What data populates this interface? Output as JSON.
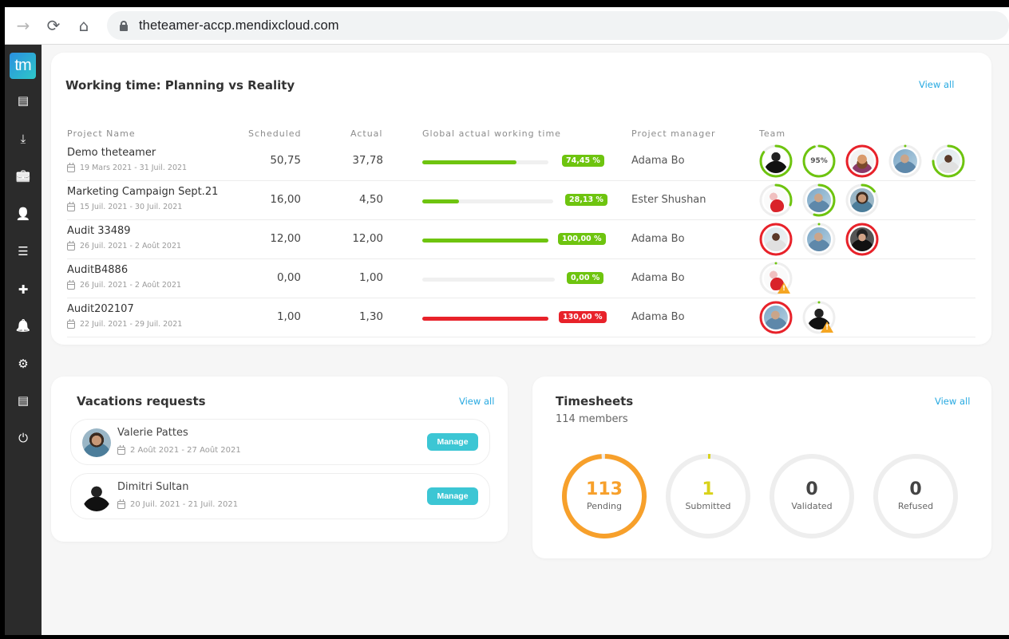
{
  "browser": {
    "url": "theteamer-accp.mendixcloud.com",
    "icons": [
      "forward-arrow-icon",
      "reload-icon",
      "home-icon",
      "lock-icon"
    ]
  },
  "sidebar": {
    "logo_text": "tm",
    "items": [
      {
        "name": "list-icon",
        "glyph": "▤"
      },
      {
        "name": "download-icon",
        "glyph": "⤓"
      },
      {
        "name": "briefcase-icon",
        "glyph": "💼"
      },
      {
        "name": "user-icon",
        "glyph": "👤"
      },
      {
        "name": "bullet-list-icon",
        "glyph": "☰"
      },
      {
        "name": "plus-icon",
        "glyph": "✚"
      },
      {
        "name": "bell-icon",
        "glyph": "🔔"
      },
      {
        "name": "gear-icon",
        "glyph": "⚙"
      },
      {
        "name": "report-icon",
        "glyph": "▤"
      },
      {
        "name": "power-icon",
        "glyph": "⏻"
      }
    ]
  },
  "working_time": {
    "title": "Working time: Planning vs Reality",
    "view_all": "View all",
    "headers": {
      "project": "Project Name",
      "scheduled": "Scheduled",
      "actual": "Actual",
      "global": "Global actual working time",
      "manager": "Project manager",
      "team": "Team"
    },
    "rows": [
      {
        "name": "Demo theteamer",
        "dates": "19 Mars 2021 - 31 Juil. 2021",
        "scheduled": "50,75",
        "actual": "37,78",
        "progress": 74.45,
        "percent_label": "74,45 %",
        "status": "ok",
        "manager": "Adama Bo",
        "team": [
          {
            "ring": 0.85,
            "status": "ok",
            "avatar": "dark"
          },
          {
            "ring": 0.95,
            "status": "ok",
            "label": "95%"
          },
          {
            "ring": 1.0,
            "status": "over",
            "avatar": "beard"
          },
          {
            "ring": 0.0,
            "status": "none",
            "avatar": "blue"
          },
          {
            "ring": 0.75,
            "status": "ok",
            "avatar": "smile"
          }
        ]
      },
      {
        "name": "Marketing Campaign Sept.21",
        "dates": "15 Juil. 2021 - 30 Juil. 2021",
        "scheduled": "16,00",
        "actual": "4,50",
        "progress": 28.13,
        "percent_label": "28,13 %",
        "status": "ok",
        "manager": "Ester Shushan",
        "team": [
          {
            "ring": 0.3,
            "status": "ok",
            "avatar": "red"
          },
          {
            "ring": 0.55,
            "status": "ok",
            "avatar": "blue"
          },
          {
            "ring": 0.15,
            "status": "ok",
            "avatar": "woman"
          }
        ]
      },
      {
        "name": "Audit 33489",
        "dates": "26 Juil. 2021 - 2 Août 2021",
        "scheduled": "12,00",
        "actual": "12,00",
        "progress": 100.0,
        "percent_label": "100,00 %",
        "status": "ok",
        "manager": "Adama Bo",
        "team": [
          {
            "ring": 1.0,
            "status": "over",
            "avatar": "smile"
          },
          {
            "ring": 0.0,
            "status": "none",
            "avatar": "blue"
          },
          {
            "ring": 1.0,
            "status": "over",
            "avatar": "darkhair"
          }
        ]
      },
      {
        "name": "AuditB4886",
        "dates": "26 Juil. 2021 - 2 Août 2021",
        "scheduled": "0,00",
        "actual": "1,00",
        "progress": 0.0,
        "percent_label": "0,00 %",
        "status": "ok",
        "manager": "Adama Bo",
        "team": [
          {
            "ring": 0.0,
            "status": "none",
            "avatar": "red",
            "warning": true
          }
        ]
      },
      {
        "name": "Audit202107",
        "dates": "22 Juil. 2021 - 29 Juil. 2021",
        "scheduled": "1,00",
        "actual": "1,30",
        "progress": 130.0,
        "percent_label": "130,00 %",
        "status": "over",
        "manager": "Adama Bo",
        "team": [
          {
            "ring": 1.0,
            "status": "over",
            "avatar": "blue"
          },
          {
            "ring": 0.0,
            "status": "none",
            "avatar": "dark",
            "warning": true
          }
        ]
      }
    ]
  },
  "vacations": {
    "title": "Vacations requests",
    "view_all": "View all",
    "items": [
      {
        "name": "Valerie Pattes",
        "dates": "2 Août 2021 - 27 Août 2021",
        "button": "Manage",
        "avatar": "woman"
      },
      {
        "name": "Dimitri Sultan",
        "dates": "20 Juil. 2021 - 21 Juil. 2021",
        "button": "Manage",
        "avatar": "dark"
      }
    ]
  },
  "timesheets": {
    "title": "Timesheets",
    "subtitle": "114 members",
    "view_all": "View all",
    "total": 114,
    "stats": [
      {
        "value": "113",
        "count": 113,
        "label": "Pending",
        "color": "#f7a02b"
      },
      {
        "value": "1",
        "count": 1,
        "label": "Submitted",
        "color": "#d9d21a"
      },
      {
        "value": "0",
        "count": 0,
        "label": "Validated",
        "color": "#444444"
      },
      {
        "value": "0",
        "count": 0,
        "label": "Refused",
        "color": "#444444"
      }
    ]
  },
  "colors": {
    "ok": "#6ec40f",
    "over": "#e8222a",
    "accent": "#27a9e1",
    "manage": "#3cc6d4",
    "ring_track": "#eeeeee"
  }
}
